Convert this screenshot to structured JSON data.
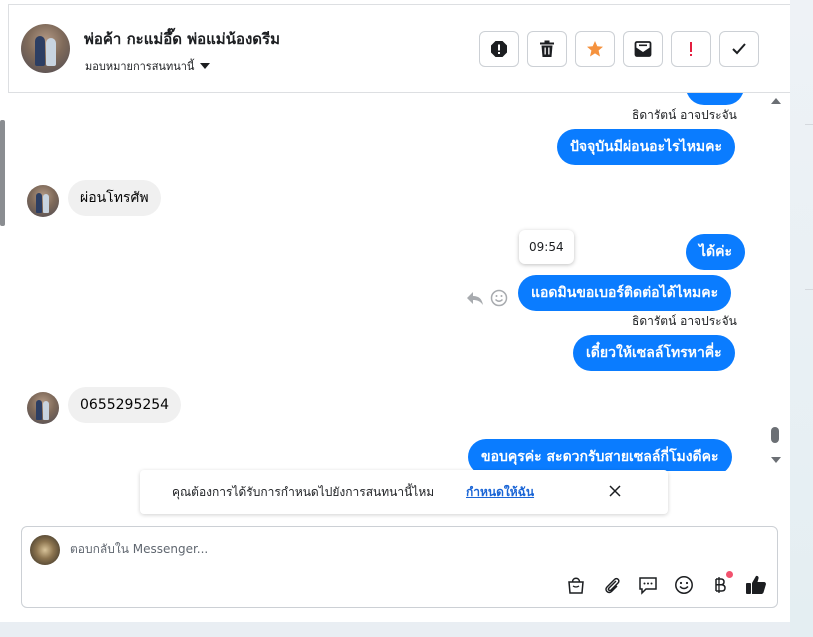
{
  "header": {
    "contact_name": "พ่อค้า กะแม่อึ๊ด พ่อแม่น้องดรีม",
    "assign_label": "มอบหมายการสนทนานี้"
  },
  "actions": [
    {
      "name": "spam-button",
      "icon": "alert-octagon-icon"
    },
    {
      "name": "delete-button",
      "icon": "trash-icon"
    },
    {
      "name": "star-button",
      "icon": "star-icon"
    },
    {
      "name": "mark-unread-button",
      "icon": "envelope-icon"
    },
    {
      "name": "follow-up-button",
      "icon": "exclamation-icon"
    },
    {
      "name": "mark-done-button",
      "icon": "check-icon"
    }
  ],
  "conversation": {
    "sender_1": "ธิดารัตน์ อาจประจัน",
    "msg_1": "ปัจจุบันมีผ่อนอะไรไหมคะ",
    "msg_2": "ผ่อนโทรศัพ",
    "tooltip_time": "09:54",
    "msg_3": "ได้ค่ะ",
    "msg_4": "แอดมินขอเบอร์ติดต่อได้ไหมคะ",
    "sender_2": "ธิดารัตน์ อาจประจัน",
    "msg_5": "เดี๋ยวให้เซลล์โทรหาคี่ะ",
    "msg_6": "0655295254",
    "msg_7": "ขอบคุรค่ะ สะดวกรับสายเซลล์กี่โมงดีคะ"
  },
  "notice": {
    "text": "คุณต้องการได้รับการกำหนดไปยังการสนทนานี้ไหม",
    "link": "กำหนดให้ฉัน"
  },
  "composer": {
    "placeholder": "ตอบกลับใน Messenger..."
  },
  "colors": {
    "outgoing_bubble": "#0a7cff",
    "incoming_bubble": "#f0f0f0",
    "star": "#f5923e",
    "follow_up": "#e41e3f",
    "link": "#1a65d6",
    "badge_dot": "#f2526e"
  }
}
